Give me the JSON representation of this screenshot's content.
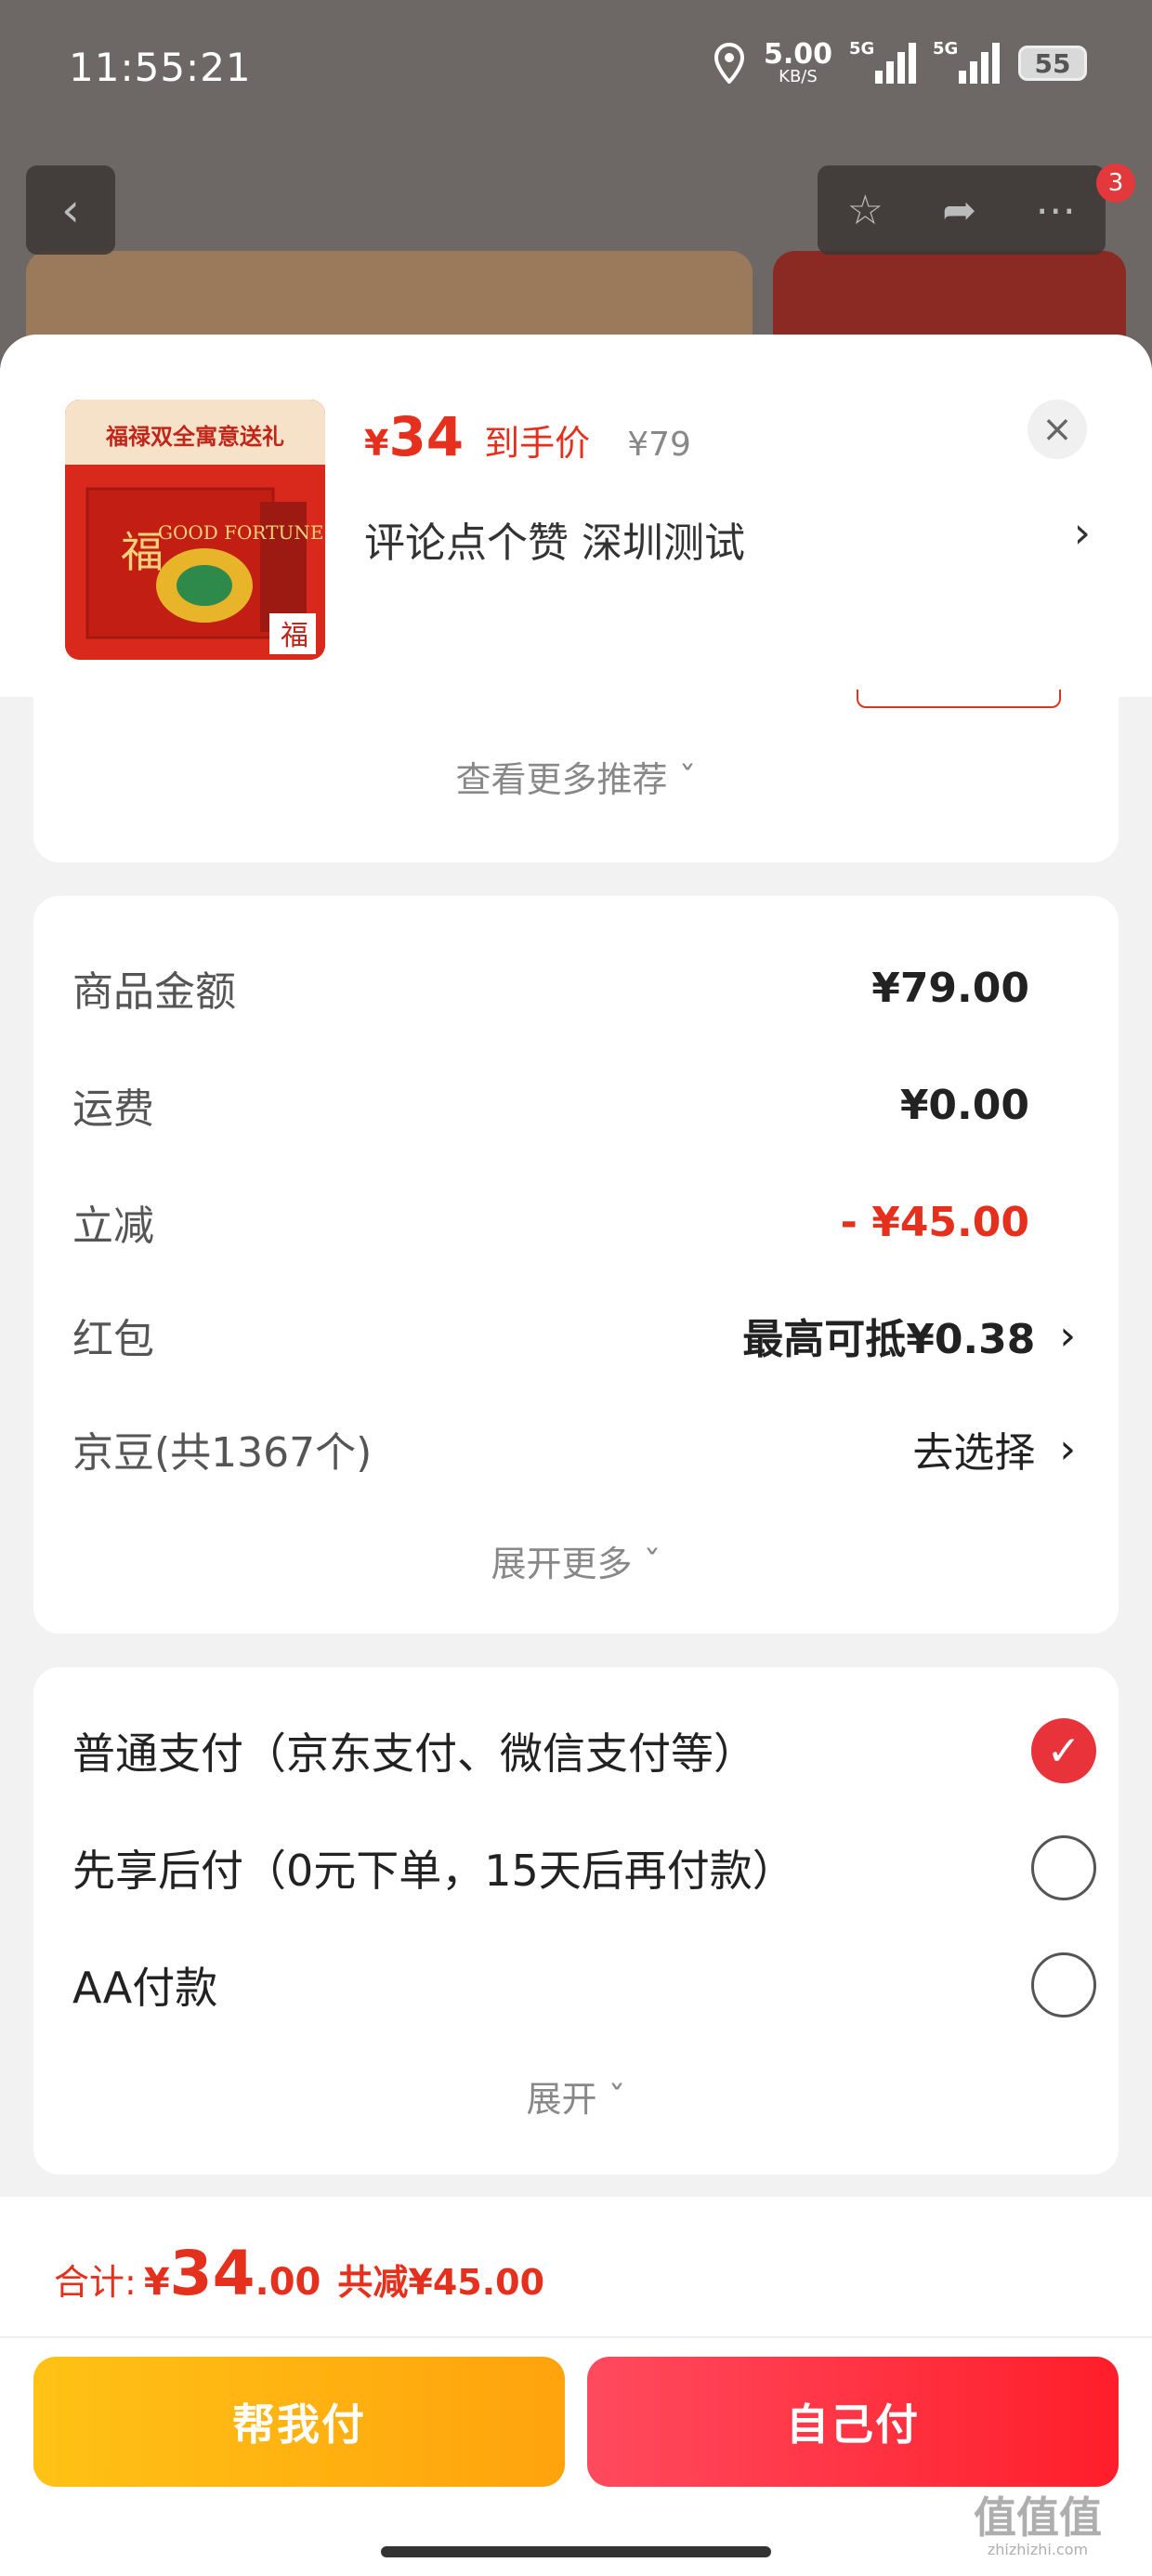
{
  "status_bar": {
    "time": "11:55:21",
    "net_speed": "5.00",
    "net_unit": "KB/S",
    "signal1_label": "5G",
    "signal2_label": "5G",
    "battery": "55"
  },
  "nav": {
    "back_icon": "chevron-left-icon",
    "favorite_icon": "star-icon",
    "share_icon": "share-icon",
    "more_icon": "more-icon",
    "cart_badge": "3"
  },
  "product": {
    "thumb_banner": "福禄双全寓意送礼",
    "thumb_brand": "GOOD FORTUNE",
    "price_yen": "¥",
    "price": "34",
    "price_tag": "到手价",
    "original_price": "¥79",
    "variant": "评论点个赞  深圳测试",
    "variant_arrow": "›",
    "close_icon": "close-icon"
  },
  "recommend": {
    "more_label": "查看更多推荐 ˇ"
  },
  "fees": {
    "rows": [
      {
        "label": "商品金额",
        "value": "¥79.00"
      },
      {
        "label": "运费",
        "value": "¥0.00"
      },
      {
        "label": "立减",
        "value": "- ¥45.00"
      },
      {
        "label": "红包",
        "value": "最高可抵¥0.38"
      },
      {
        "label": "京豆(共1367个)",
        "value": "去选择"
      }
    ],
    "expand_label": "展开更多 ˇ"
  },
  "payment": {
    "options": [
      {
        "label": "普通支付（京东支付、微信支付等）",
        "selected": true
      },
      {
        "label": "先享后付（0元下单，15天后再付款）",
        "selected": false
      },
      {
        "label": "AA付款",
        "selected": false
      }
    ],
    "expand_label": "展开 ˇ"
  },
  "summary": {
    "label": "合计:",
    "yen": "¥",
    "amount_int": "34",
    "amount_dec": ".00",
    "savings": "共减¥45.00"
  },
  "actions": {
    "help_pay": "帮我付",
    "self_pay": "自己付"
  },
  "watermark": {
    "text": "值值值",
    "sub": "zhizhizhi.com"
  },
  "colors": {
    "accent": "#e4301c",
    "help_button": "#ffb414",
    "self_button": "#ff2d3c"
  }
}
